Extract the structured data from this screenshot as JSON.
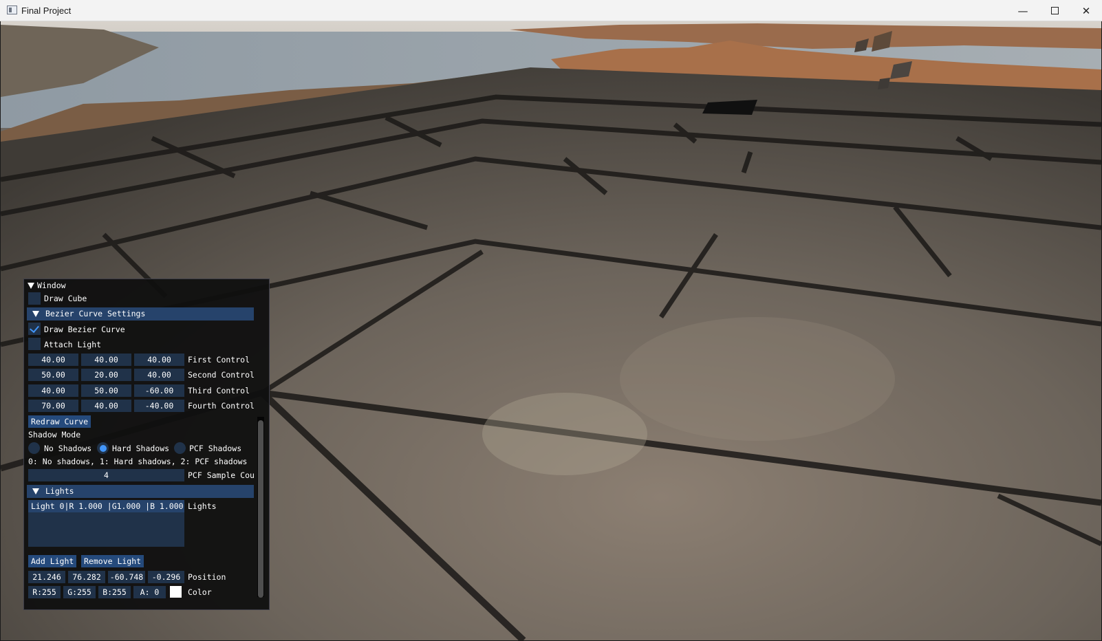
{
  "app": {
    "title": "Final Project"
  },
  "window_controls": {
    "minimize": "—",
    "close": "✕"
  },
  "imgui": {
    "title": "Window",
    "draw_cube": {
      "label": "Draw Cube",
      "checked": false
    },
    "bezier": {
      "header": "Bezier Curve Settings",
      "draw_bezier": {
        "label": "Draw Bezier Curve",
        "checked": true
      },
      "attach_light": {
        "label": "Attach Light",
        "checked": false
      },
      "controls": [
        {
          "label": "First Control",
          "values": [
            "40.00",
            "40.00",
            "40.00"
          ]
        },
        {
          "label": "Second Control",
          "values": [
            "50.00",
            "20.00",
            "40.00"
          ]
        },
        {
          "label": "Third Control",
          "values": [
            "40.00",
            "50.00",
            "-60.00"
          ]
        },
        {
          "label": "Fourth Control",
          "values": [
            "70.00",
            "40.00",
            "-40.00"
          ]
        }
      ],
      "redraw_button": "Redraw Curve",
      "shadow_mode_label": "Shadow Mode",
      "shadow_options": [
        "No Shadows",
        "Hard Shadows",
        "PCF Shadows"
      ],
      "shadow_selected": "Hard Shadows",
      "shadow_help": "0: No shadows, 1: Hard shadows, 2: PCF shadows",
      "pcf_sample_count": {
        "value": "4",
        "label": "PCF Sample Cou"
      }
    },
    "lights": {
      "header": "Lights",
      "list_items": [
        "Light 0|R 1.000 |G1.000 |B 1.000"
      ],
      "list_label": "Lights",
      "add_button": "Add Light",
      "remove_button": "Remove Light",
      "position": {
        "values": [
          "21.246",
          "76.282",
          "-60.748",
          "-0.296"
        ],
        "label": "Position"
      },
      "color": {
        "values": [
          "R:255",
          "G:255",
          "B:255",
          "A:  0"
        ],
        "label": "Color",
        "swatch": "#ffffff"
      }
    }
  },
  "colors": {
    "header_bg": "#26436b",
    "frame_bg": "#203249",
    "button_bg": "#254a7c",
    "check_mark": "#4296fa"
  }
}
